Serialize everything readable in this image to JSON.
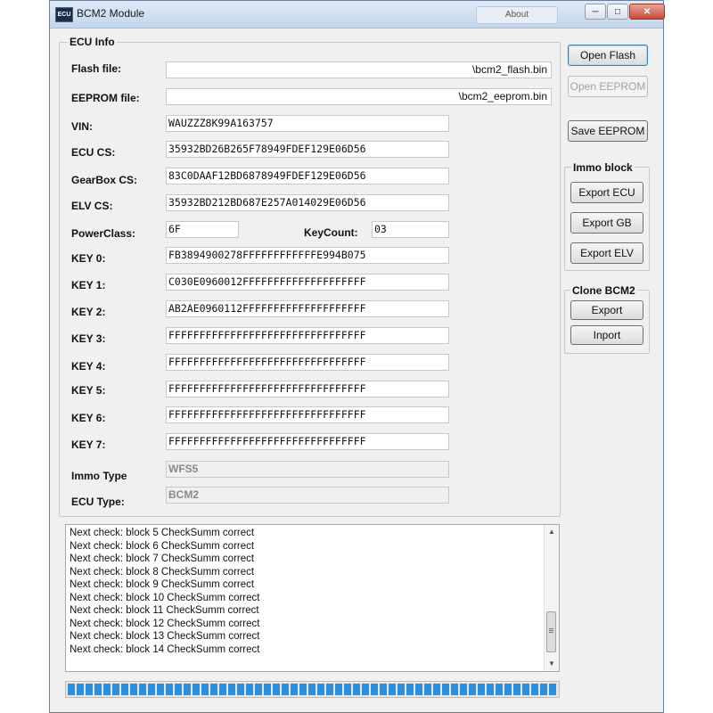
{
  "window": {
    "title": "BCM2 Module",
    "icon_text": "ECU",
    "background_tab": "About",
    "buttons": {
      "minimize": "─",
      "maximize": "□",
      "close": "✕"
    }
  },
  "ecu_info": {
    "legend": "ECU Info",
    "flash_file": {
      "label": "Flash file:",
      "value": "\\bcm2_flash.bin"
    },
    "eeprom_file": {
      "label": "EEPROM file:",
      "value": "\\bcm2_eeprom.bin"
    },
    "vin": {
      "label": "VIN:",
      "value": "WAUZZZ8K99A163757"
    },
    "ecu_cs": {
      "label": "ECU CS:",
      "value": "35932BD26B265F78949FDEF129E06D56"
    },
    "gearbox_cs": {
      "label": "GearBox CS:",
      "value": "83C0DAAF12BD6878949FDEF129E06D56"
    },
    "elv_cs": {
      "label": "ELV CS:",
      "value": "35932BD212BD687E257A014029E06D56"
    },
    "power_class": {
      "label": "PowerClass:",
      "value": "6F"
    },
    "key_count": {
      "label": "KeyCount:",
      "value": "03"
    },
    "keys": [
      {
        "label": "KEY 0:",
        "value": "FB3894900278FFFFFFFFFFFFE994B075"
      },
      {
        "label": "KEY 1:",
        "value": "C030E0960012FFFFFFFFFFFFFFFFFFFF"
      },
      {
        "label": "KEY 2:",
        "value": "AB2AE0960112FFFFFFFFFFFFFFFFFFFF"
      },
      {
        "label": "KEY 3:",
        "value": "FFFFFFFFFFFFFFFFFFFFFFFFFFFFFFFF"
      },
      {
        "label": "KEY 4:",
        "value": "FFFFFFFFFFFFFFFFFFFFFFFFFFFFFFFF"
      },
      {
        "label": "KEY 5:",
        "value": "FFFFFFFFFFFFFFFFFFFFFFFFFFFFFFFF"
      },
      {
        "label": "KEY 6:",
        "value": "FFFFFFFFFFFFFFFFFFFFFFFFFFFFFFFF"
      },
      {
        "label": "KEY 7:",
        "value": "FFFFFFFFFFFFFFFFFFFFFFFFFFFFFFFF"
      }
    ],
    "immo_type": {
      "label": "Immo Type",
      "value": "WFS5"
    },
    "ecu_type": {
      "label": "ECU Type:",
      "value": "BCM2"
    }
  },
  "actions": {
    "open_flash": "Open Flash",
    "open_eeprom": "Open EEPROM",
    "save_eeprom": "Save EEPROM"
  },
  "immo_block": {
    "legend": "Immo block",
    "export_ecu": "Export ECU",
    "export_gb": "Export GB",
    "export_elv": "Export ELV"
  },
  "clone_bcm2": {
    "legend": "Clone BCM2",
    "export": "Export",
    "import": "Inport"
  },
  "log": [
    "Next check: block 5 CheckSumm correct",
    "Next check: block 6 CheckSumm correct",
    "Next check: block 7 CheckSumm correct",
    "Next check: block 8 CheckSumm correct",
    "Next check: block 9 CheckSumm correct",
    "Next check: block 10 CheckSumm correct",
    "Next check: block 11 CheckSumm correct",
    "Next check: block 12 CheckSumm correct",
    "Next check: block 13 CheckSumm correct",
    "Next check: block 14 CheckSumm correct"
  ],
  "progress": {
    "value": 1.0
  },
  "colors": {
    "progress": "#2a8fe0",
    "close_button": "#c74a37"
  }
}
